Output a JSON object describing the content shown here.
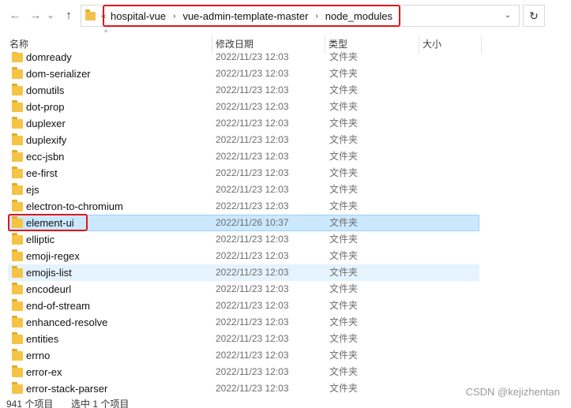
{
  "nav": {
    "back_glyph": "←",
    "forward_glyph": "→",
    "history_glyph": "⌄",
    "up_glyph": "↑",
    "refresh_glyph": "↻",
    "overflow_glyph": "«",
    "separator_glyph": "›",
    "dropdown_glyph": "⌄"
  },
  "breadcrumbs": [
    "hospital-vue",
    "vue-admin-template-master",
    "node_modules"
  ],
  "columns": {
    "name": "名称",
    "date": "修改日期",
    "type": "类型",
    "size": "大小",
    "sort_glyph": "^"
  },
  "files": [
    {
      "name": "domready",
      "date": "2022/11/23 12:03",
      "type": "文件夹"
    },
    {
      "name": "dom-serializer",
      "date": "2022/11/23 12:03",
      "type": "文件夹"
    },
    {
      "name": "domutils",
      "date": "2022/11/23 12:03",
      "type": "文件夹"
    },
    {
      "name": "dot-prop",
      "date": "2022/11/23 12:03",
      "type": "文件夹"
    },
    {
      "name": "duplexer",
      "date": "2022/11/23 12:03",
      "type": "文件夹"
    },
    {
      "name": "duplexify",
      "date": "2022/11/23 12:03",
      "type": "文件夹"
    },
    {
      "name": "ecc-jsbn",
      "date": "2022/11/23 12:03",
      "type": "文件夹"
    },
    {
      "name": "ee-first",
      "date": "2022/11/23 12:03",
      "type": "文件夹"
    },
    {
      "name": "ejs",
      "date": "2022/11/23 12:03",
      "type": "文件夹"
    },
    {
      "name": "electron-to-chromium",
      "date": "2022/11/23 12:03",
      "type": "文件夹"
    },
    {
      "name": "element-ui",
      "date": "2022/11/26 10:37",
      "type": "文件夹",
      "state": "selected"
    },
    {
      "name": "elliptic",
      "date": "2022/11/23 12:03",
      "type": "文件夹"
    },
    {
      "name": "emoji-regex",
      "date": "2022/11/23 12:03",
      "type": "文件夹"
    },
    {
      "name": "emojis-list",
      "date": "2022/11/23 12:03",
      "type": "文件夹",
      "state": "hover"
    },
    {
      "name": "encodeurl",
      "date": "2022/11/23 12:03",
      "type": "文件夹"
    },
    {
      "name": "end-of-stream",
      "date": "2022/11/23 12:03",
      "type": "文件夹"
    },
    {
      "name": "enhanced-resolve",
      "date": "2022/11/23 12:03",
      "type": "文件夹"
    },
    {
      "name": "entities",
      "date": "2022/11/23 12:03",
      "type": "文件夹"
    },
    {
      "name": "errno",
      "date": "2022/11/23 12:03",
      "type": "文件夹"
    },
    {
      "name": "error-ex",
      "date": "2022/11/23 12:03",
      "type": "文件夹"
    },
    {
      "name": "error-stack-parser",
      "date": "2022/11/23 12:03",
      "type": "文件夹"
    }
  ],
  "status": {
    "item_count": "941 个项目",
    "selection": "选中 1 个项目"
  },
  "watermark": "CSDN @kejizhentan",
  "colors": {
    "highlight_box": "#e0161c",
    "selected_row": "#cce8ff",
    "hover_row": "#e5f3ff",
    "folder": "#f5c445"
  }
}
